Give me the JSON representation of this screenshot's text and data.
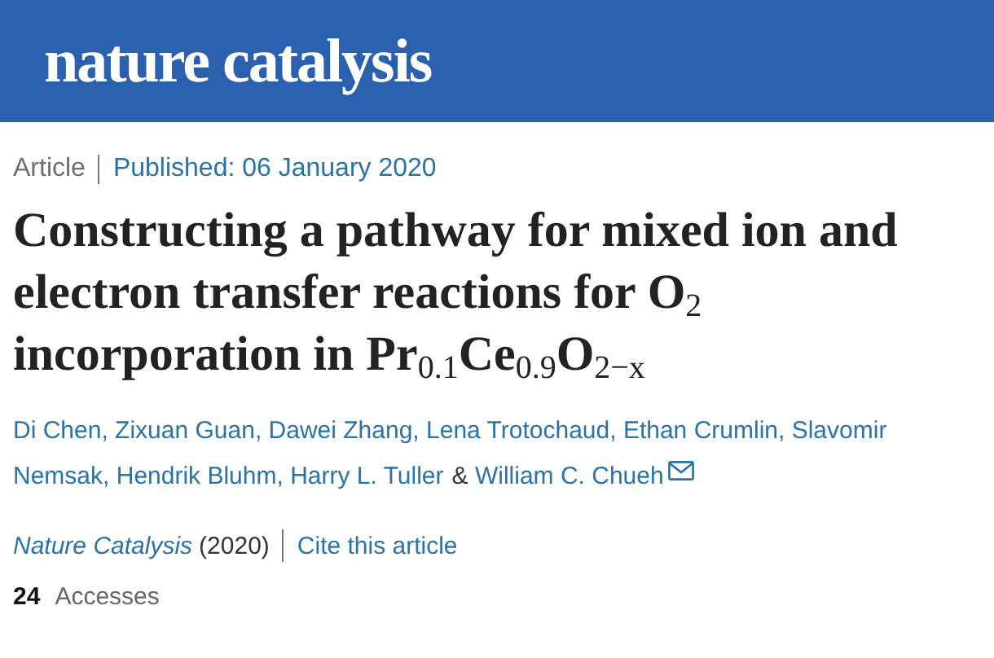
{
  "header": {
    "logo": "nature catalysis"
  },
  "meta": {
    "type": "Article",
    "published": "Published: 06 January 2020"
  },
  "title": "Constructing a pathway for mixed ion and electron transfer reactions for O$_{2}$ incorporation in Pr$_{0.1}$Ce$_{0.9}$O$_{2−x}$",
  "authors": [
    {
      "name": "Di Chen",
      "separator": ",",
      "mail": false
    },
    {
      "name": "Zixuan Guan",
      "separator": ",",
      "mail": false
    },
    {
      "name": "Dawei Zhang",
      "separator": ",",
      "mail": false
    },
    {
      "name": "Lena Trotochaud",
      "separator": ",",
      "mail": false
    },
    {
      "name": "Ethan Crumlin",
      "separator": ",",
      "mail": false
    },
    {
      "name_lines": [
        "Slavomir",
        "Nemsak"
      ],
      "separator": ",",
      "mail": false
    },
    {
      "name": "Hendrik Bluhm",
      "separator": ",",
      "mail": false
    },
    {
      "name": "Harry L. Tuller",
      "separator": "&",
      "mail": false
    },
    {
      "name": "William C. Chueh",
      "mail": true
    }
  ],
  "citation": {
    "journal": "Nature Catalysis",
    "year": "(2020)",
    "cite_link": "Cite this article"
  },
  "metrics": {
    "count": "24",
    "label": "Accesses"
  }
}
